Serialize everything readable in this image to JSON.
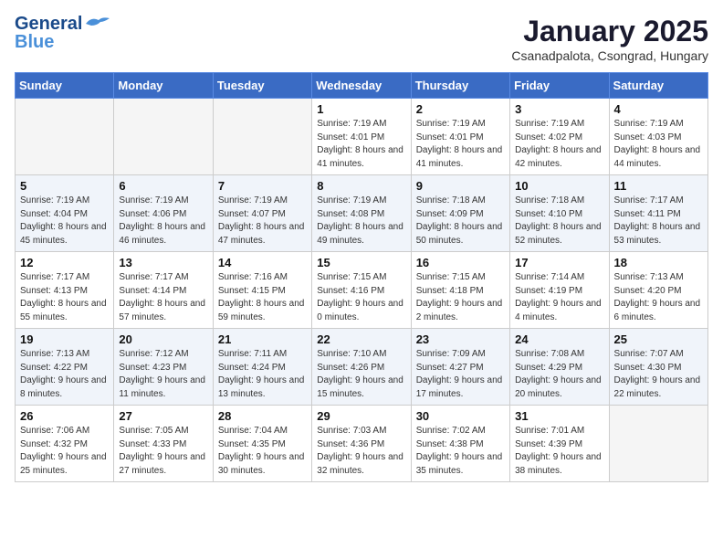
{
  "logo": {
    "line1": "General",
    "line2": "Blue"
  },
  "title": "January 2025",
  "subtitle": "Csanadpalota, Csongrad, Hungary",
  "days_of_week": [
    "Sunday",
    "Monday",
    "Tuesday",
    "Wednesday",
    "Thursday",
    "Friday",
    "Saturday"
  ],
  "weeks": [
    [
      {
        "day": "",
        "info": ""
      },
      {
        "day": "",
        "info": ""
      },
      {
        "day": "",
        "info": ""
      },
      {
        "day": "1",
        "info": "Sunrise: 7:19 AM\nSunset: 4:01 PM\nDaylight: 8 hours and 41 minutes."
      },
      {
        "day": "2",
        "info": "Sunrise: 7:19 AM\nSunset: 4:01 PM\nDaylight: 8 hours and 41 minutes."
      },
      {
        "day": "3",
        "info": "Sunrise: 7:19 AM\nSunset: 4:02 PM\nDaylight: 8 hours and 42 minutes."
      },
      {
        "day": "4",
        "info": "Sunrise: 7:19 AM\nSunset: 4:03 PM\nDaylight: 8 hours and 44 minutes."
      }
    ],
    [
      {
        "day": "5",
        "info": "Sunrise: 7:19 AM\nSunset: 4:04 PM\nDaylight: 8 hours and 45 minutes."
      },
      {
        "day": "6",
        "info": "Sunrise: 7:19 AM\nSunset: 4:06 PM\nDaylight: 8 hours and 46 minutes."
      },
      {
        "day": "7",
        "info": "Sunrise: 7:19 AM\nSunset: 4:07 PM\nDaylight: 8 hours and 47 minutes."
      },
      {
        "day": "8",
        "info": "Sunrise: 7:19 AM\nSunset: 4:08 PM\nDaylight: 8 hours and 49 minutes."
      },
      {
        "day": "9",
        "info": "Sunrise: 7:18 AM\nSunset: 4:09 PM\nDaylight: 8 hours and 50 minutes."
      },
      {
        "day": "10",
        "info": "Sunrise: 7:18 AM\nSunset: 4:10 PM\nDaylight: 8 hours and 52 minutes."
      },
      {
        "day": "11",
        "info": "Sunrise: 7:17 AM\nSunset: 4:11 PM\nDaylight: 8 hours and 53 minutes."
      }
    ],
    [
      {
        "day": "12",
        "info": "Sunrise: 7:17 AM\nSunset: 4:13 PM\nDaylight: 8 hours and 55 minutes."
      },
      {
        "day": "13",
        "info": "Sunrise: 7:17 AM\nSunset: 4:14 PM\nDaylight: 8 hours and 57 minutes."
      },
      {
        "day": "14",
        "info": "Sunrise: 7:16 AM\nSunset: 4:15 PM\nDaylight: 8 hours and 59 minutes."
      },
      {
        "day": "15",
        "info": "Sunrise: 7:15 AM\nSunset: 4:16 PM\nDaylight: 9 hours and 0 minutes."
      },
      {
        "day": "16",
        "info": "Sunrise: 7:15 AM\nSunset: 4:18 PM\nDaylight: 9 hours and 2 minutes."
      },
      {
        "day": "17",
        "info": "Sunrise: 7:14 AM\nSunset: 4:19 PM\nDaylight: 9 hours and 4 minutes."
      },
      {
        "day": "18",
        "info": "Sunrise: 7:13 AM\nSunset: 4:20 PM\nDaylight: 9 hours and 6 minutes."
      }
    ],
    [
      {
        "day": "19",
        "info": "Sunrise: 7:13 AM\nSunset: 4:22 PM\nDaylight: 9 hours and 8 minutes."
      },
      {
        "day": "20",
        "info": "Sunrise: 7:12 AM\nSunset: 4:23 PM\nDaylight: 9 hours and 11 minutes."
      },
      {
        "day": "21",
        "info": "Sunrise: 7:11 AM\nSunset: 4:24 PM\nDaylight: 9 hours and 13 minutes."
      },
      {
        "day": "22",
        "info": "Sunrise: 7:10 AM\nSunset: 4:26 PM\nDaylight: 9 hours and 15 minutes."
      },
      {
        "day": "23",
        "info": "Sunrise: 7:09 AM\nSunset: 4:27 PM\nDaylight: 9 hours and 17 minutes."
      },
      {
        "day": "24",
        "info": "Sunrise: 7:08 AM\nSunset: 4:29 PM\nDaylight: 9 hours and 20 minutes."
      },
      {
        "day": "25",
        "info": "Sunrise: 7:07 AM\nSunset: 4:30 PM\nDaylight: 9 hours and 22 minutes."
      }
    ],
    [
      {
        "day": "26",
        "info": "Sunrise: 7:06 AM\nSunset: 4:32 PM\nDaylight: 9 hours and 25 minutes."
      },
      {
        "day": "27",
        "info": "Sunrise: 7:05 AM\nSunset: 4:33 PM\nDaylight: 9 hours and 27 minutes."
      },
      {
        "day": "28",
        "info": "Sunrise: 7:04 AM\nSunset: 4:35 PM\nDaylight: 9 hours and 30 minutes."
      },
      {
        "day": "29",
        "info": "Sunrise: 7:03 AM\nSunset: 4:36 PM\nDaylight: 9 hours and 32 minutes."
      },
      {
        "day": "30",
        "info": "Sunrise: 7:02 AM\nSunset: 4:38 PM\nDaylight: 9 hours and 35 minutes."
      },
      {
        "day": "31",
        "info": "Sunrise: 7:01 AM\nSunset: 4:39 PM\nDaylight: 9 hours and 38 minutes."
      },
      {
        "day": "",
        "info": ""
      }
    ]
  ]
}
